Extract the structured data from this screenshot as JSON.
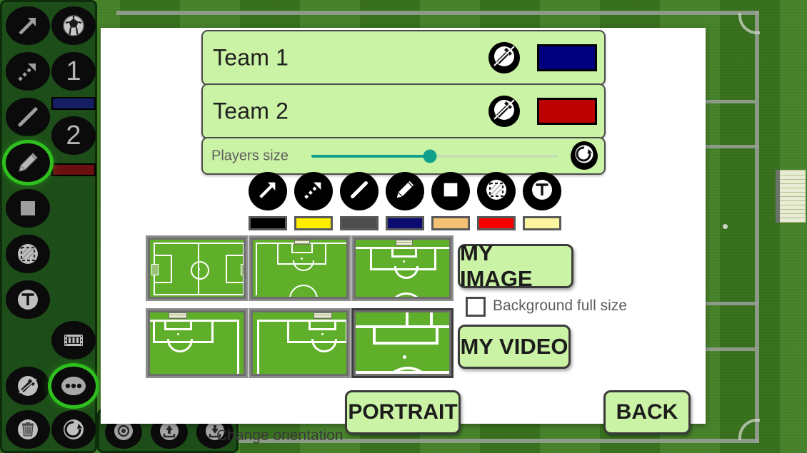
{
  "app": {
    "background": "soccer-field",
    "field_color": "#3e7d20",
    "line_color": "#97a096"
  },
  "sidebar": {
    "name": "drawing-tools-toolbar",
    "items": [
      {
        "id": "arrow-tool",
        "icon": "arrow-up-right-icon",
        "label": "Arrow",
        "selected": false
      },
      {
        "id": "ball-tool",
        "icon": "soccer-ball-icon",
        "label": "Ball",
        "selected": false
      },
      {
        "id": "dashed-arrow-tool",
        "icon": "dashed-arrow-icon",
        "label": "Dashed arrow",
        "selected": false
      },
      {
        "id": "team1-player-tool",
        "icon": "number-1-icon",
        "label": "1",
        "selected": false
      },
      {
        "id": "line-tool",
        "icon": "line-icon",
        "label": "Line",
        "selected": false
      },
      {
        "id": "team2-player-tool",
        "icon": "number-2-icon",
        "label": "2",
        "selected": false
      },
      {
        "id": "pencil-tool",
        "icon": "pencil-icon",
        "label": "Pencil",
        "selected": true
      },
      {
        "id": "rectangle-tool",
        "icon": "filled-square-icon",
        "label": "Rectangle",
        "selected": false
      },
      {
        "id": "zone-tool",
        "icon": "dashed-square-icon",
        "label": "Zone",
        "selected": false
      },
      {
        "id": "text-tool",
        "icon": "text-t-icon",
        "label": "Text",
        "selected": false
      },
      {
        "id": "film-tool",
        "icon": "film-strip-icon",
        "label": "Animation",
        "selected": false
      },
      {
        "id": "settings-tool",
        "icon": "hammer-wrench-icon",
        "label": "Settings",
        "selected": false
      },
      {
        "id": "more-tool",
        "icon": "three-dots-icon",
        "label": "More",
        "selected": true
      },
      {
        "id": "delete-tool",
        "icon": "trash-icon",
        "label": "Delete",
        "selected": false
      },
      {
        "id": "reset-tool",
        "icon": "reset-circle-arrow-icon",
        "label": "Reset",
        "selected": false
      }
    ],
    "team1_color": "#151d63",
    "team2_color": "#6b1010"
  },
  "bottom_bar": {
    "name": "capture-toolbar",
    "items": [
      {
        "id": "camera-button",
        "icon": "camera-icon",
        "label": "Camera"
      },
      {
        "id": "share-button",
        "icon": "share-upload-icon",
        "label": "Share"
      },
      {
        "id": "save-button",
        "icon": "download-save-icon",
        "label": "Save"
      }
    ]
  },
  "dialog": {
    "teams": [
      {
        "name": "Team 1",
        "edit_icon": "hammer-wrench-icon",
        "color": "#00007f",
        "color_name": "navy"
      },
      {
        "name": "Team 2",
        "edit_icon": "hammer-wrench-icon",
        "color": "#bd0000",
        "color_name": "red"
      }
    ],
    "players_size": {
      "label": "Players size",
      "value_percent": 48,
      "fill_color": "#10a08c",
      "reset_icon": "reset-circle-arrow-icon"
    },
    "draw_tools": [
      {
        "id": "arrow-tool",
        "icon": "arrow-up-right-icon",
        "label": "Arrow"
      },
      {
        "id": "dashed-arrow-tool",
        "icon": "dashed-arrow-icon",
        "label": "Dashed arrow"
      },
      {
        "id": "line-tool",
        "icon": "line-icon",
        "label": "Line"
      },
      {
        "id": "pencil-tool",
        "icon": "pencil-icon",
        "label": "Pencil"
      },
      {
        "id": "rectangle-tool",
        "icon": "filled-square-icon",
        "label": "Rectangle"
      },
      {
        "id": "zone-tool",
        "icon": "dashed-square-icon",
        "label": "Zone"
      },
      {
        "id": "text-tool",
        "icon": "text-t-icon",
        "label": "Text"
      }
    ],
    "color_swatches": [
      {
        "name": "black",
        "hex": "#000000"
      },
      {
        "name": "yellow",
        "hex": "#ffee00"
      },
      {
        "name": "gray",
        "hex": "#4d4d4d"
      },
      {
        "name": "navy",
        "hex": "#0b0b72"
      },
      {
        "name": "tan",
        "hex": "#f5c275"
      },
      {
        "name": "red",
        "hex": "#f50000"
      },
      {
        "name": "light-yellow",
        "hex": "#fbf5a0"
      }
    ],
    "field_presets": [
      {
        "id": "full-pitch",
        "label": "Full pitch",
        "selected": false
      },
      {
        "id": "half-pitch-top",
        "label": "Half pitch top",
        "selected": false
      },
      {
        "id": "attacking-third-right",
        "label": "Attacking third right",
        "selected": false
      },
      {
        "id": "penalty-area-left",
        "label": "Penalty area left",
        "selected": false
      },
      {
        "id": "penalty-area-right",
        "label": "Penalty area right",
        "selected": false
      },
      {
        "id": "goal-area-zoom",
        "label": "Goal area zoom",
        "selected": true
      }
    ],
    "my_image_label": "MY IMAGE",
    "background_full_size": {
      "label": "Background full size",
      "checked": false
    },
    "my_video_label": "MY VIDEO",
    "change_orientation_label": "Change orientation",
    "portrait_label": "PORTRAIT",
    "back_label": "BACK",
    "button_bg": "#cbf3a5"
  }
}
